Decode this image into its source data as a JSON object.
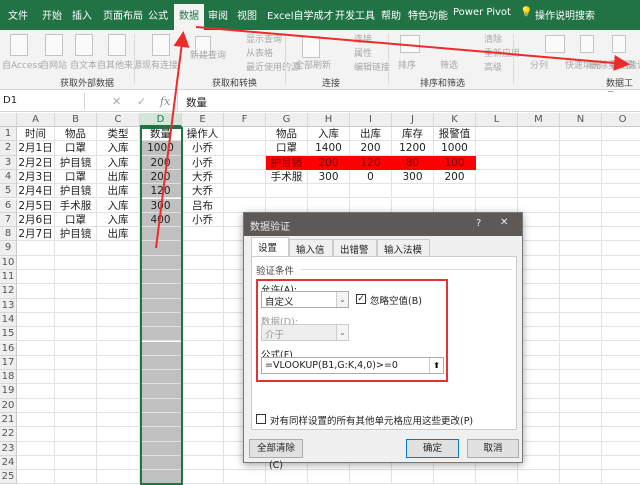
{
  "tabs": [
    "文件",
    "开始",
    "插入",
    "页面布局",
    "公式",
    "数据",
    "审阅",
    "视图",
    "Excel自学成才",
    "开发工具",
    "帮助",
    "特色功能",
    "Power Pivot",
    "操作说明搜索"
  ],
  "active_tab": "数据",
  "ribbon": {
    "buttons": [
      "自Access",
      "自网站",
      "自文本",
      "自其他来源",
      "现有连接",
      "新建查询",
      "显示查询",
      "从表格",
      "最近使用的源",
      "全部刷新",
      "连接",
      "属性",
      "编辑链接",
      "排序",
      "筛选",
      "清除",
      "重新应用",
      "高级",
      "分列",
      "快速填充",
      "删除重复值",
      "数据验证"
    ],
    "groups": [
      "获取外部数据",
      "获取和转换",
      "连接",
      "排序和筛选",
      "数据工具"
    ]
  },
  "formula_bar": {
    "name_box": "D1",
    "fx": "fx",
    "content": "数量"
  },
  "columns": [
    "A",
    "B",
    "C",
    "D",
    "E",
    "F",
    "G",
    "H",
    "I",
    "J",
    "K",
    "L",
    "M",
    "N",
    "O"
  ],
  "sheet1": {
    "rows": [
      [
        "时间",
        "物品",
        "类型",
        "数量",
        "操作人"
      ],
      [
        "2月1日",
        "口罩",
        "入库",
        "1000",
        "小乔"
      ],
      [
        "2月2日",
        "护目镜",
        "入库",
        "200",
        "小乔"
      ],
      [
        "2月3日",
        "口罩",
        "出库",
        "200",
        "大乔"
      ],
      [
        "2月4日",
        "护目镜",
        "出库",
        "120",
        "大乔"
      ],
      [
        "2月5日",
        "手术服",
        "入库",
        "300",
        "吕布"
      ],
      [
        "2月6日",
        "口罩",
        "入库",
        "400",
        "小乔"
      ],
      [
        "2月7日",
        "护目镜",
        "出库",
        "",
        ""
      ]
    ]
  },
  "sheet2": {
    "rows": [
      [
        "物品",
        "入库",
        "出库",
        "库存",
        "报警值"
      ],
      [
        "口罩",
        "1400",
        "200",
        "1200",
        "1000"
      ],
      [
        "护目镜",
        "200",
        "120",
        "80",
        "100"
      ],
      [
        "手术服",
        "300",
        "0",
        "300",
        "200"
      ]
    ],
    "highlight_row": 2,
    "highlight_color": "#ff0000"
  },
  "dialog": {
    "title": "数据验证",
    "help": "?",
    "close": "✕",
    "tabs": [
      "设置",
      "输入信息",
      "出错警告",
      "输入法模式"
    ],
    "section": "验证条件",
    "allow_label": "允许(A):",
    "allow_value": "自定义",
    "ignore_blank": "忽略空值(B)",
    "ignore_blank_checked": true,
    "data_label": "数据(D):",
    "data_value": "介于",
    "formula_label": "公式(F)",
    "formula_value": "=VLOOKUP(B1,G:K,4,0)>=0",
    "apply_all": "对有同样设置的所有其他单元格应用这些更改(P)",
    "clear_all": "全部清除(C)",
    "ok": "确定",
    "cancel": "取消"
  },
  "colors": {
    "excel_green": "#217346",
    "annotation_red": "#ee2a2a",
    "selection_gray": "#c0c0c0"
  }
}
